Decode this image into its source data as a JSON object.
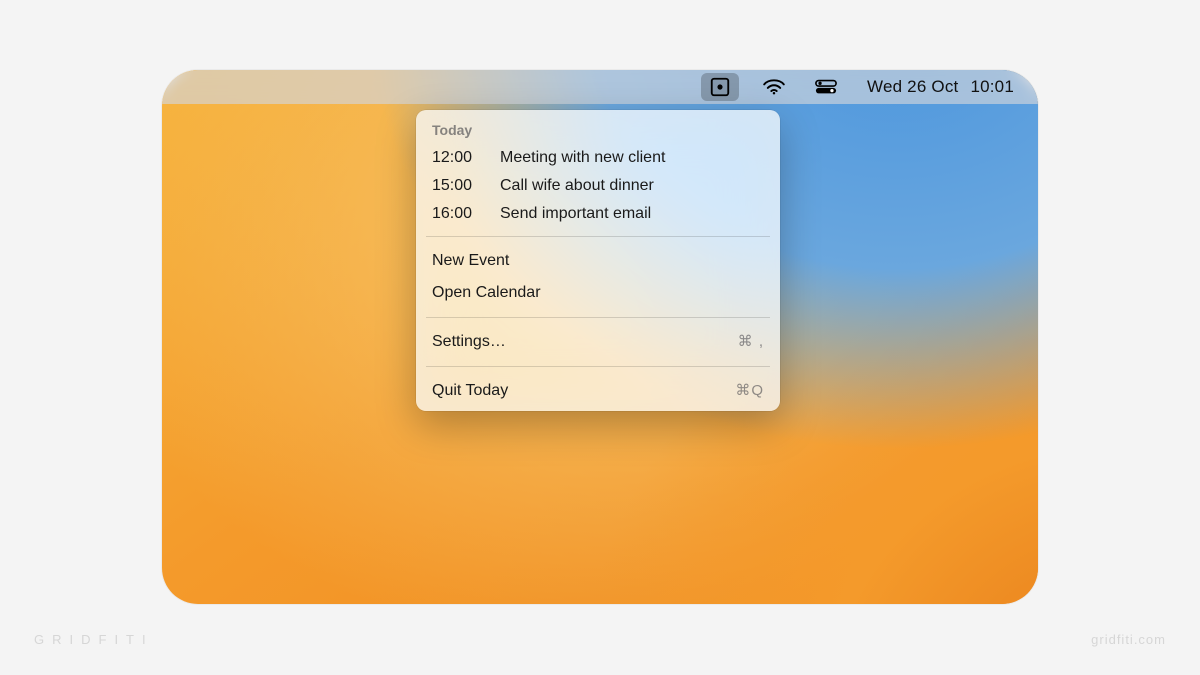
{
  "menubar": {
    "date": "Wed 26 Oct",
    "time": "10:01"
  },
  "dropdown": {
    "section_title": "Today",
    "events": [
      {
        "time": "12:00",
        "title": "Meeting with new client"
      },
      {
        "time": "15:00",
        "title": "Call wife about dinner"
      },
      {
        "time": "16:00",
        "title": "Send important email"
      }
    ],
    "actions": {
      "new_event": "New Event",
      "open_calendar": "Open Calendar",
      "settings_label": "Settings…",
      "settings_shortcut": "⌘ ,",
      "quit_label": "Quit Today",
      "quit_shortcut": "⌘Q"
    }
  },
  "watermark": {
    "left": "GRIDFITI",
    "right": "gridfiti.com"
  }
}
